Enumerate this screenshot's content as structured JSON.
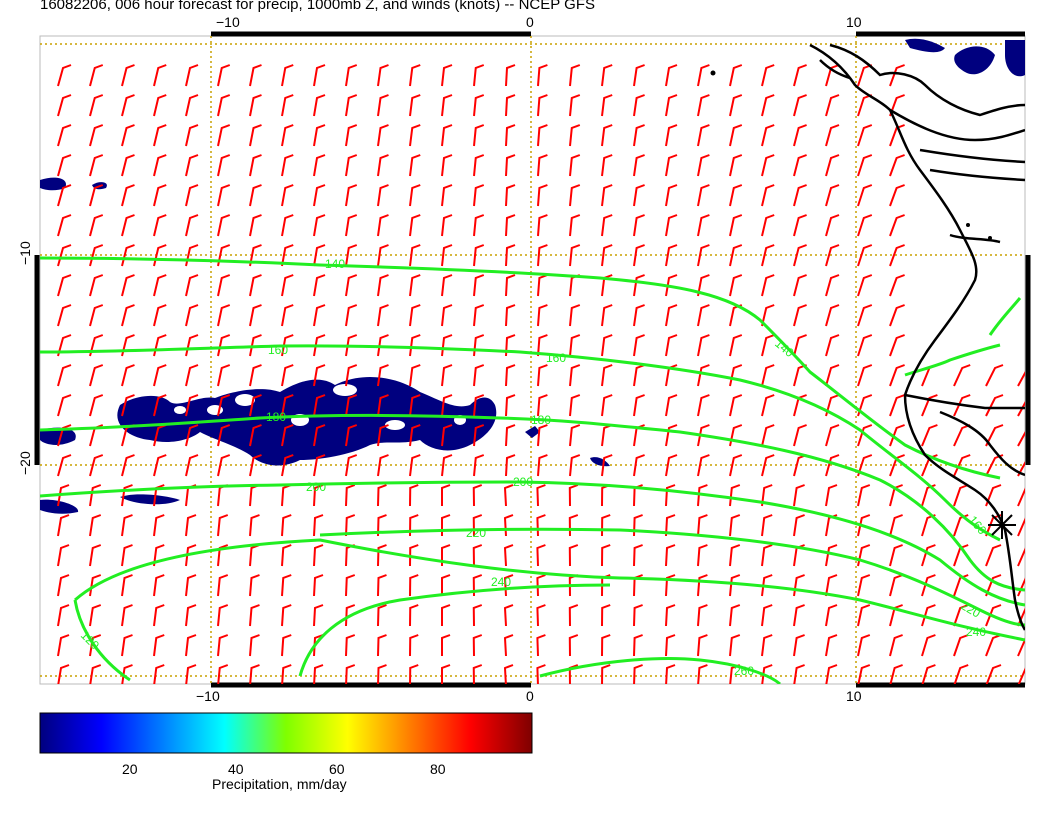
{
  "title": "16082206, 006 hour forecast for precip, 1000mb Z, and winds (knots) -- NCEP GFS",
  "map": {
    "x_ticks": [
      "−10",
      "0",
      "10"
    ],
    "y_ticks": [
      "−10",
      "−20"
    ],
    "bottom_ticks": [
      "−10",
      "0",
      "10"
    ],
    "contour_labels": [
      "140",
      "160",
      "180",
      "200",
      "220",
      "240",
      "260",
      "140",
      "160",
      "180",
      "200",
      "220",
      "240",
      "160",
      "120"
    ]
  },
  "colorbar": {
    "label": "Precipitation, mm/day",
    "ticks": [
      "20",
      "40",
      "60",
      "80"
    ]
  },
  "colors": {
    "wind_barbs": "#ff0000",
    "contours": "#22ee22",
    "precip_low": "#00007f",
    "gridlines": "#c8a000",
    "coast": "#000000"
  },
  "icons": [
    "wind-barb-icon",
    "star-marker-icon"
  ]
}
